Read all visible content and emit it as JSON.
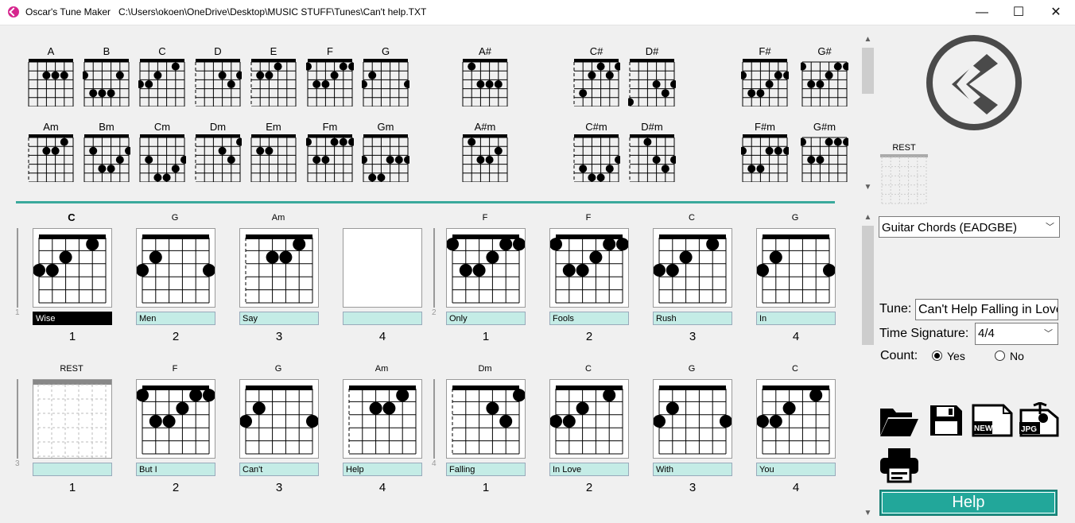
{
  "window": {
    "app_name": "Oscar's Tune Maker",
    "file_path": "C:\\Users\\okoen\\OneDrive\\Desktop\\MUSIC STUFF\\Tunes\\Can't help.TXT",
    "minimize": "—",
    "maximize": "☐",
    "close": "✕"
  },
  "palette": {
    "major_row": [
      "A",
      "B",
      "C",
      "D",
      "E",
      "F",
      "G",
      "A#",
      "C#",
      "D#",
      "F#",
      "G#"
    ],
    "minor_row": [
      "Am",
      "Bm",
      "Cm",
      "Dm",
      "Em",
      "Fm",
      "Gm",
      "A#m",
      "C#m",
      "D#m",
      "F#m",
      "G#m"
    ],
    "fret_marker": "4",
    "rest_label": "REST"
  },
  "bars": [
    {
      "number": "1",
      "cells": [
        {
          "chord": "C",
          "lyric": "Wise",
          "beat": "1"
        },
        {
          "chord": "G",
          "lyric": "Men",
          "beat": "2"
        },
        {
          "chord": "Am",
          "lyric": "Say",
          "beat": "3"
        },
        {
          "chord": "",
          "lyric": "",
          "beat": "4"
        }
      ]
    },
    {
      "number": "2",
      "cells": [
        {
          "chord": "F",
          "lyric": "Only",
          "beat": "1"
        },
        {
          "chord": "F",
          "lyric": "Fools",
          "beat": "2"
        },
        {
          "chord": "C",
          "lyric": "Rush",
          "beat": "3"
        },
        {
          "chord": "G",
          "lyric": "In",
          "beat": "4"
        }
      ]
    },
    {
      "number": "3",
      "cells": [
        {
          "chord": "REST",
          "lyric": "",
          "beat": "1"
        },
        {
          "chord": "F",
          "lyric": "But I",
          "beat": "2"
        },
        {
          "chord": "G",
          "lyric": "Can't",
          "beat": "3"
        },
        {
          "chord": "Am",
          "lyric": "Help",
          "beat": "4"
        }
      ]
    },
    {
      "number": "4",
      "cells": [
        {
          "chord": "Dm",
          "lyric": "Falling",
          "beat": "1"
        },
        {
          "chord": "C",
          "lyric": "In Love",
          "beat": "2"
        },
        {
          "chord": "G",
          "lyric": "With",
          "beat": "3"
        },
        {
          "chord": "C",
          "lyric": "You",
          "beat": "4"
        }
      ]
    }
  ],
  "side": {
    "rest_label": "REST",
    "instrument": "Guitar Chords (EADGBE)",
    "tune_label": "Tune:",
    "tune_value": "Can't Help Falling in Love",
    "time_sig_label": "Time Signature:",
    "time_sig_value": "4/4",
    "count_label": "Count:",
    "count_yes": "Yes",
    "count_no": "No",
    "count_selected": "Yes",
    "new_label": "NEW",
    "jpg_label": "JPG",
    "help": "Help"
  },
  "colors": {
    "accent": "#22a79a",
    "lyric_bg": "#c4ece6",
    "logo_gray": "#4a4a4a"
  },
  "icons": [
    "app-icon",
    "open-folder-icon",
    "save-disk-icon",
    "new-file-icon",
    "export-jpg-icon",
    "printer-icon",
    "logo-icon"
  ]
}
